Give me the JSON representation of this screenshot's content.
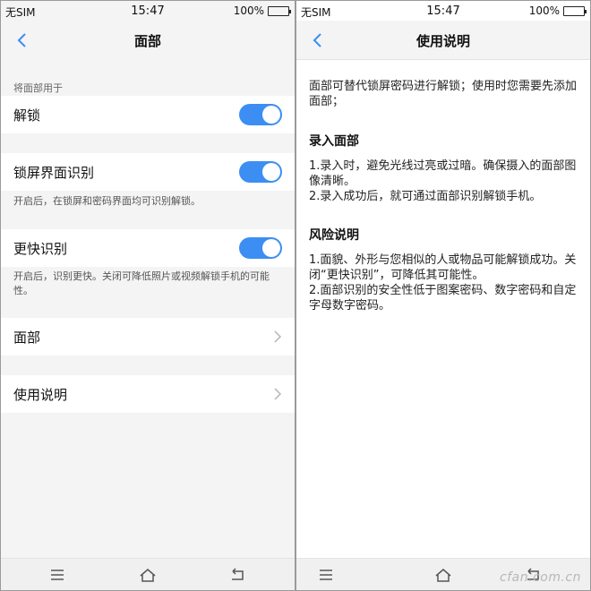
{
  "left_screen": {
    "status": {
      "carrier": "无SIM",
      "time": "15:47",
      "battery": "100%"
    },
    "title": "面部",
    "section_label": "将面部用于",
    "settings": [
      {
        "label": "解锁",
        "toggle_on": true
      },
      {
        "label": "锁屏界面识别",
        "toggle_on": true,
        "hint": "开启后，在锁屏和密码界面均可识别解锁。"
      },
      {
        "label": "更快识别",
        "toggle_on": true,
        "hint": "开启后，识别更快。关闭可降低照片或视频解锁手机的可能性。"
      }
    ],
    "links": [
      {
        "label": "面部"
      },
      {
        "label": "使用说明"
      }
    ]
  },
  "right_screen": {
    "status": {
      "carrier": "无SIM",
      "time": "15:47",
      "battery": "100%"
    },
    "title": "使用说明",
    "intro": "面部可替代锁屏密码进行解锁；使用时您需要先添加面部；",
    "sections": [
      {
        "heading": "录入面部",
        "lines": [
          "1.录入时，避免光线过亮或过暗。确保摄入的面部图像清晰。",
          "2.录入成功后，就可通过面部识别解锁手机。"
        ]
      },
      {
        "heading": "风险说明",
        "lines": [
          "1.面貌、外形与您相似的人或物品可能解锁成功。关闭“更快识别”，可降低其可能性。",
          "2.面部识别的安全性低于图案密码、数字密码和自定字母数字密码。"
        ]
      }
    ]
  },
  "watermark": "cfan.com.cn",
  "colors": {
    "accent": "#3c8ef3",
    "toggle_knob": "#ffffff",
    "panel_bg": "#f4f4f4"
  },
  "icons": {
    "back": "chevron-left-icon",
    "row": "chevron-right-icon",
    "menu": "menu-icon",
    "home": "home-icon",
    "return": "return-icon"
  }
}
